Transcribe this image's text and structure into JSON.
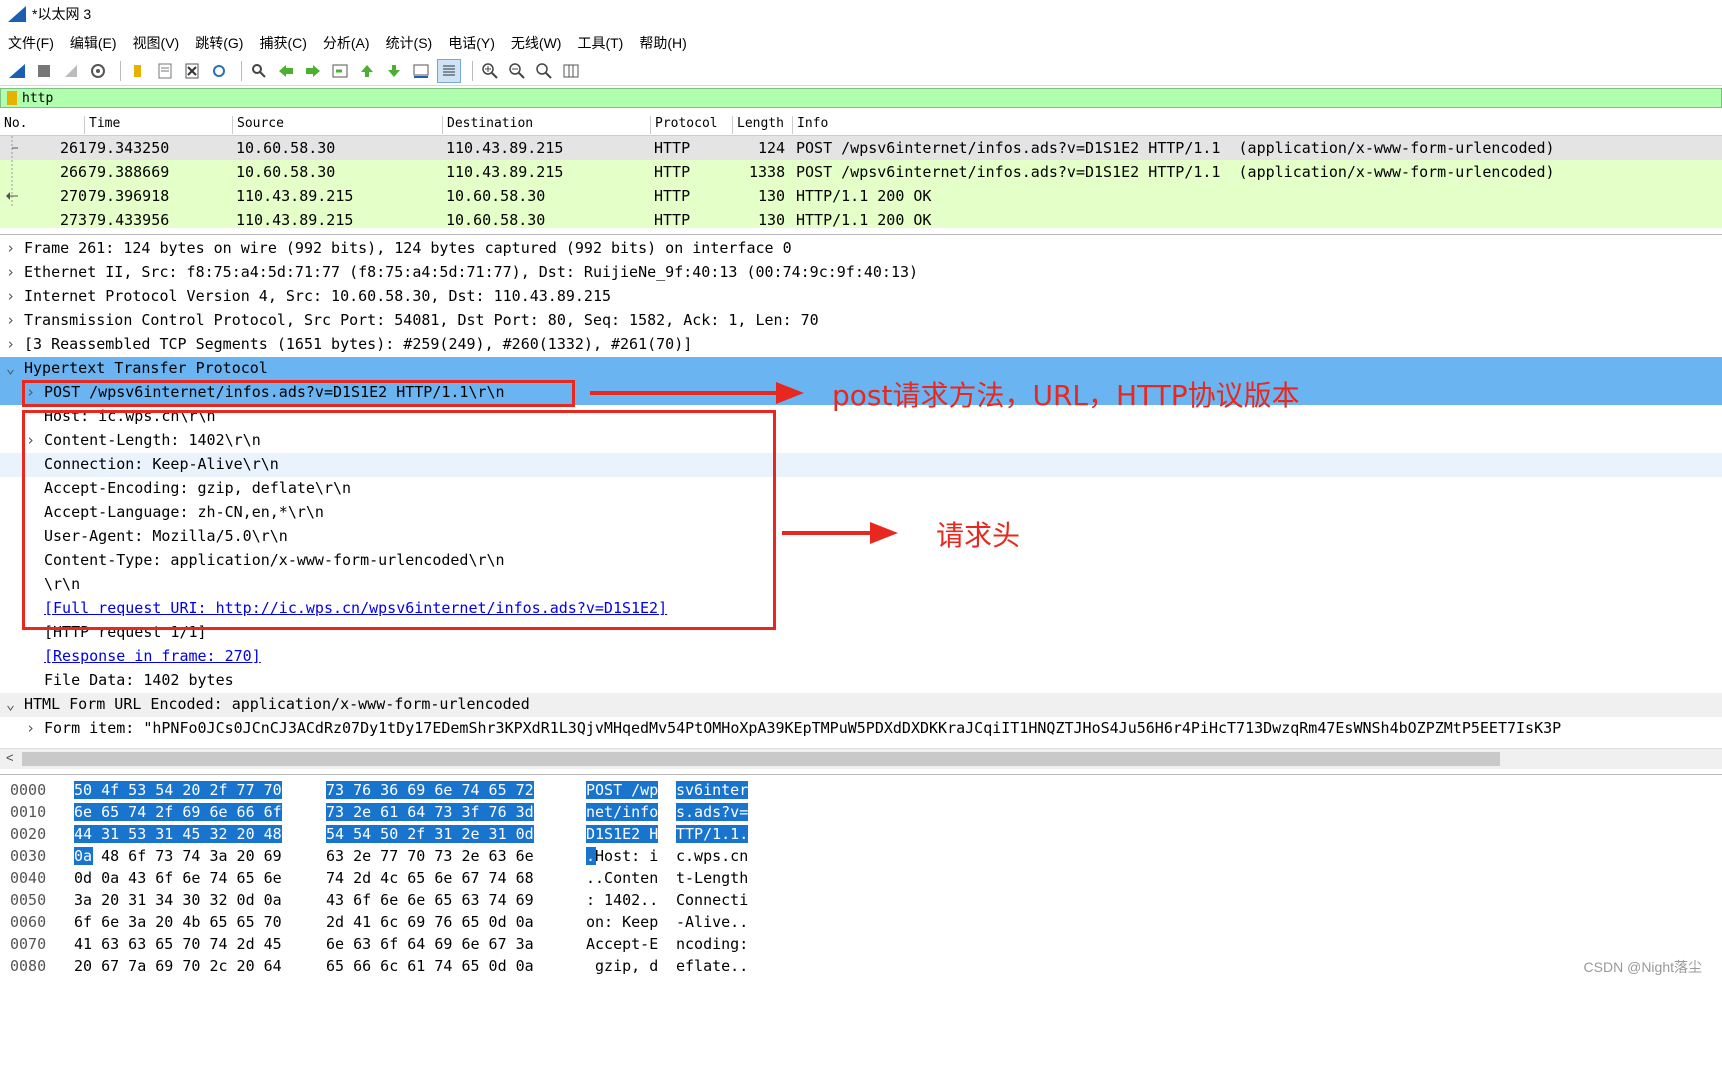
{
  "window": {
    "title": "*以太网 3"
  },
  "menu": [
    "文件(F)",
    "编辑(E)",
    "视图(V)",
    "跳转(G)",
    "捕获(C)",
    "分析(A)",
    "统计(S)",
    "电话(Y)",
    "无线(W)",
    "工具(T)",
    "帮助(H)"
  ],
  "toolbar": {
    "icons": [
      "shark-fin-icon",
      "stop-icon",
      "restart-icon",
      "options-gear-icon",
      "open-folder-icon",
      "save-file-icon",
      "close-file-icon",
      "reload-icon",
      "find-icon",
      "go-back-icon",
      "go-forward-icon",
      "go-to-packet-icon",
      "first-packet-icon",
      "last-packet-icon",
      "autoscroll-icon",
      "colorize-icon",
      "zoom-in-icon",
      "zoom-out-icon",
      "zoom-normal-icon",
      "resize-columns-icon"
    ]
  },
  "filter": {
    "value": "http"
  },
  "packet_list": {
    "columns": [
      "No.",
      "Time",
      "Source",
      "Destination",
      "Protocol",
      "Length",
      "Info"
    ],
    "rows": [
      {
        "no": "261",
        "time": "79.343250",
        "source": "10.60.58.30",
        "destination": "110.43.89.215",
        "protocol": "HTTP",
        "length": "124",
        "info": "POST /wpsv6internet/infos.ads?v=D1S1E2 HTTP/1.1  (application/x-www-form-urlencoded)",
        "bg": "#e4e4e4"
      },
      {
        "no": "266",
        "time": "79.388669",
        "source": "10.60.58.30",
        "destination": "110.43.89.215",
        "protocol": "HTTP",
        "length": "1338",
        "info": "POST /wpsv6internet/infos.ads?v=D1S1E2 HTTP/1.1  (application/x-www-form-urlencoded)",
        "bg": "#e4ffc7"
      },
      {
        "no": "270",
        "time": "79.396918",
        "source": "110.43.89.215",
        "destination": "10.60.58.30",
        "protocol": "HTTP",
        "length": "130",
        "info": "HTTP/1.1 200 OK",
        "bg": "#e4ffc7"
      },
      {
        "no": "273",
        "time": "79.433956",
        "source": "110.43.89.215",
        "destination": "10.60.58.30",
        "protocol": "HTTP",
        "length": "130",
        "info": "HTTP/1.1 200 OK",
        "bg": "#e4ffc7"
      }
    ]
  },
  "details": [
    {
      "text": "Frame 261: 124 bytes on wire (992 bits), 124 bytes captured (992 bits) on interface 0",
      "arrow": "›",
      "level": 0
    },
    {
      "text": "Ethernet II, Src: f8:75:a4:5d:71:77 (f8:75:a4:5d:71:77), Dst: RuijieNe_9f:40:13 (00:74:9c:9f:40:13)",
      "arrow": "›",
      "level": 0
    },
    {
      "text": "Internet Protocol Version 4, Src: 10.60.58.30, Dst: 110.43.89.215",
      "arrow": "›",
      "level": 0
    },
    {
      "text": "Transmission Control Protocol, Src Port: 54081, Dst Port: 80, Seq: 1582, Ack: 1, Len: 70",
      "arrow": "›",
      "level": 0
    },
    {
      "text": "[3 Reassembled TCP Segments (1651 bytes): #259(249), #260(1332), #261(70)]",
      "arrow": "›",
      "level": 0
    },
    {
      "text": "Hypertext Transfer Protocol",
      "arrow": "⌄",
      "level": 0
    },
    {
      "text": "POST /wpsv6internet/infos.ads?v=D1S1E2 HTTP/1.1\\r\\n",
      "arrow": "›",
      "level": 1
    },
    {
      "text": "Host: ic.wps.cn\\r\\n",
      "arrow": "",
      "level": 1
    },
    {
      "text": "Content-Length: 1402\\r\\n",
      "arrow": "›",
      "level": 1
    },
    {
      "text": "Connection: Keep-Alive\\r\\n",
      "arrow": "",
      "level": 1
    },
    {
      "text": "Accept-Encoding: gzip, deflate\\r\\n",
      "arrow": "",
      "level": 1
    },
    {
      "text": "Accept-Language: zh-CN,en,*\\r\\n",
      "arrow": "",
      "level": 1
    },
    {
      "text": "User-Agent: Mozilla/5.0\\r\\n",
      "arrow": "",
      "level": 1
    },
    {
      "text": "Content-Type: application/x-www-form-urlencoded\\r\\n",
      "arrow": "",
      "level": 1
    },
    {
      "text": "\\r\\n",
      "arrow": "",
      "level": 1
    },
    {
      "text": "[Full request URI: http://ic.wps.cn/wpsv6internet/infos.ads?v=D1S1E2]",
      "arrow": "",
      "level": 1
    },
    {
      "text": "[HTTP request 1/1]",
      "arrow": "",
      "level": 1
    },
    {
      "text": "[Response in frame: 270]",
      "arrow": "",
      "level": 1
    },
    {
      "text": "File Data: 1402 bytes",
      "arrow": "",
      "level": 1
    },
    {
      "text": "HTML Form URL Encoded: application/x-www-form-urlencoded",
      "arrow": "⌄",
      "level": 0
    },
    {
      "text": "Form item: \"hPNFo0JCs0JCnCJ3ACdRz07Dy1tDy17EDemShr3KPXdR1L3QjvMHqedMv54PtOMHoXpA39KEpTMPuW5PDXdDXDKKraJCqiIT1HNQZTJHoS4Ju56H6r4PiHcT713DwzqRm47EsWNSh4bOZPZMtP5EET7IsK3P",
      "arrow": "›",
      "level": 1
    }
  ],
  "bytes": [
    {
      "offset": "0000",
      "hex1": "50 4f 53 54 20 2f 77 70",
      "hex2": "73 76 36 69 6e 74 65 72",
      "a1": "POST /wp",
      "a2": "sv6inter"
    },
    {
      "offset": "0010",
      "hex1": "6e 65 74 2f 69 6e 66 6f",
      "hex2": "73 2e 61 64 73 3f 76 3d",
      "a1": "net/info",
      "a2": "s.ads?v="
    },
    {
      "offset": "0020",
      "hex1": "44 31 53 31 45 32 20 48",
      "hex2": "54 54 50 2f 31 2e 31 0d",
      "a1": "D1S1E2 H",
      "a2": "TTP/1.1."
    },
    {
      "offset": "0030",
      "hex1": "0a 48 6f 73 74 3a 20 69",
      "hex2": "63 2e 77 70 73 2e 63 6e",
      "a1": ".Host: i",
      "a2": "c.wps.cn"
    },
    {
      "offset": "0040",
      "hex1": "0d 0a 43 6f 6e 74 65 6e",
      "hex2": "74 2d 4c 65 6e 67 74 68",
      "a1": "..Conten",
      "a2": "t-Length"
    },
    {
      "offset": "0050",
      "hex1": "3a 20 31 34 30 32 0d 0a",
      "hex2": "43 6f 6e 6e 65 63 74 69",
      "a1": ": 1402..",
      "a2": "Connecti"
    },
    {
      "offset": "0060",
      "hex1": "6f 6e 3a 20 4b 65 65 70",
      "hex2": "2d 41 6c 69 76 65 0d 0a",
      "a1": "on: Keep",
      "a2": "-Alive.."
    },
    {
      "offset": "0070",
      "hex1": "41 63 63 65 70 74 2d 45",
      "hex2": "6e 63 6f 64 69 6e 67 3a",
      "a1": "Accept-E",
      "a2": "ncoding:"
    },
    {
      "offset": "0080",
      "hex1": "20 67 7a 69 70 2c 20 64",
      "hex2": "65 66 6c 61 74 65 0d 0a",
      "a1": " gzip, d",
      "a2": "eflate.."
    }
  ],
  "annotations": {
    "request_line": "post请求方法，URL，HTTP协议版本",
    "request_headers": "请求头"
  },
  "watermark": "CSDN @Night落尘",
  "colors": {
    "selection": "#6ab4f2",
    "filter_bg": "#afffaf",
    "annotation_red": "#e8281e",
    "hex_highlight": "#1874cd"
  }
}
